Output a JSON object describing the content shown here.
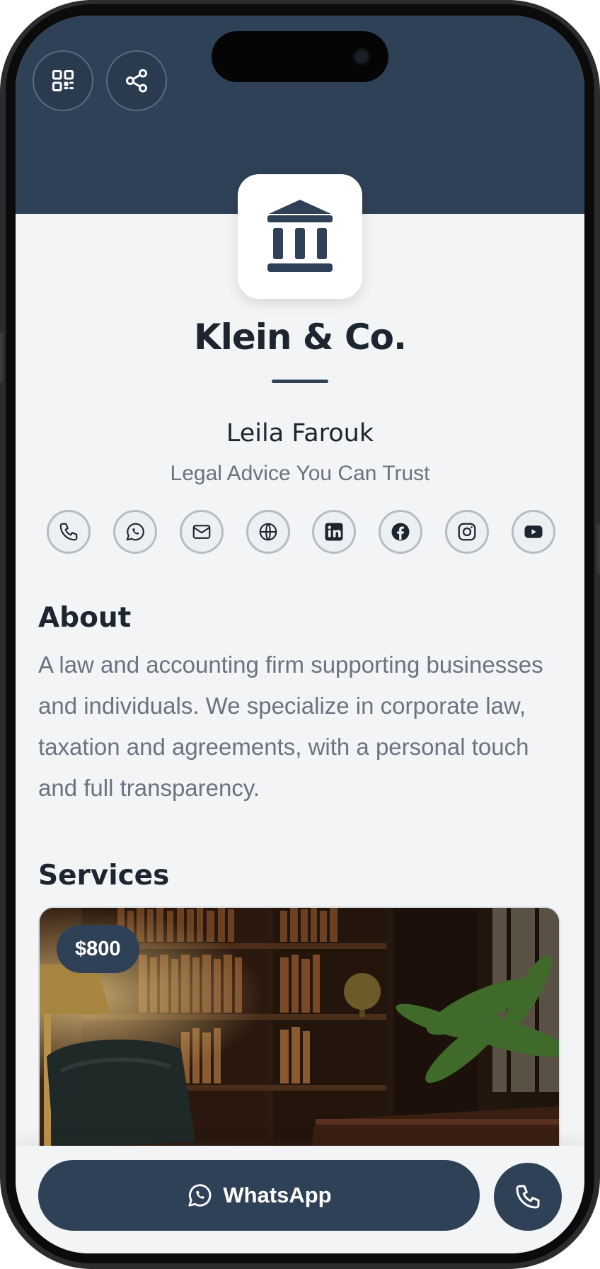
{
  "header": {
    "qr_button_icon": "qr-code-icon",
    "share_button_icon": "share-icon"
  },
  "profile": {
    "logo_icon": "bank-building-icon",
    "company_name": "Klein & Co.",
    "person_name": "Leila Farouk",
    "tagline": "Legal Advice You Can Trust"
  },
  "social_links": [
    {
      "name": "phone",
      "icon": "phone-icon"
    },
    {
      "name": "whatsapp",
      "icon": "whatsapp-icon"
    },
    {
      "name": "email",
      "icon": "mail-icon"
    },
    {
      "name": "website",
      "icon": "globe-icon"
    },
    {
      "name": "linkedin",
      "icon": "linkedin-icon"
    },
    {
      "name": "facebook",
      "icon": "facebook-icon"
    },
    {
      "name": "instagram",
      "icon": "instagram-icon"
    },
    {
      "name": "youtube",
      "icon": "youtube-icon"
    }
  ],
  "about": {
    "title": "About",
    "text": "A law and accounting firm supporting businesses and individuals. We specialize in corporate law, taxation and agreements, with a personal touch and full transparency."
  },
  "services": {
    "title": "Services",
    "items": [
      {
        "price": "$800",
        "image": "law-office-interior-photo"
      }
    ]
  },
  "actions": {
    "whatsapp_label": "WhatsApp",
    "call_icon": "phone-icon"
  },
  "colors": {
    "primary": "#2f4157",
    "background": "#f2f4f6",
    "text_dark": "#1d2530",
    "text_muted": "#6b7280"
  }
}
